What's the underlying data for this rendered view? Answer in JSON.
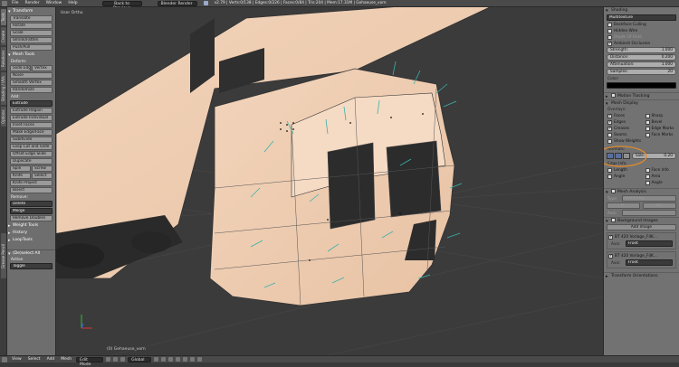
{
  "topbar": {
    "menus": [
      "File",
      "Render",
      "Window",
      "Help"
    ],
    "back_button": "Back to Previous",
    "engine": "Blender Render",
    "stats": "v2.79 | Verts:0/138 | Edges:0/226 | Faces:0/84 | Tris:204 | Mem:17.31M | Gehaeuse_vorn"
  },
  "left_tabs": [
    "Tools",
    "Create",
    "Relations",
    "Shading / UVs",
    "Options",
    "Grease Pencil"
  ],
  "toolshelf": {
    "transform_header": "Transform",
    "transform_buttons": [
      "Translate",
      "Rotate",
      "Scale",
      "Shrink/Fatten",
      "Push/Pull"
    ],
    "mesh_tools_header": "Mesh Tools",
    "deform_label": "Deform:",
    "slide_edge": "Slide Edge",
    "vertex": "Vertex",
    "deform_buttons": [
      "Noise",
      "Smooth Vertex",
      "Randomize"
    ],
    "add_label": "Add:",
    "extrude": "Extrude",
    "add_buttons": [
      "Extrude Region",
      "Extrude Individual",
      "Inset Faces",
      "Make Edge/Face",
      "Subdivide",
      "Loop Cut and Slide",
      "Offset Edge Slide",
      "Duplicate"
    ],
    "spin": "Spin",
    "screw": "Screw",
    "knife": "Knife",
    "select": "Select",
    "knife_project": "Knife Project",
    "bisect": "Bisect",
    "remove_label": "Remove:",
    "delete": "Delete",
    "merge": "Merge",
    "remove_doubles": "Remove Doubles",
    "weight_tools": "Weight Tools",
    "history": "History",
    "looptools": "LoopTools",
    "operator_header": "(De)select All",
    "action_label": "Action",
    "action_value": "Toggle"
  },
  "viewport": {
    "view_label": "User Ortho",
    "object_label": "(0) Gehaeuse_vorn"
  },
  "props": {
    "shading_header": "Shading",
    "shading_mode": "Multitexture",
    "backface": "Backface Culling",
    "hidden_wire": "Hidden Wire",
    "depth_of_field": "Depth Of Field",
    "ambient_occlusion": "Ambient Occlusion",
    "ao_fields": [
      {
        "label": "Strength:",
        "value": "1.000"
      },
      {
        "label": "Distance:",
        "value": "0.200"
      },
      {
        "label": "Attenuation:",
        "value": "1.000"
      },
      {
        "label": "Samples:",
        "value": "20"
      }
    ],
    "color_label": "Color:",
    "motion_tracking": "Motion Tracking",
    "mesh_display": "Mesh Display",
    "overlays_label": "Overlays:",
    "overlay_left": [
      "Faces",
      "Edges",
      "Creases",
      "Seams"
    ],
    "overlay_right": [
      "Sharp",
      "Bevel",
      "Edge Marks",
      "Face Marks"
    ],
    "show_weights": "Show Weights",
    "normals_label": "Normals:",
    "size_label": "Size:",
    "size_value": "0.20",
    "edge_info_label": "Edge Info:",
    "edge_info_left": [
      "Length",
      "Angle"
    ],
    "edge_info_right": [
      "Face Info",
      "Area",
      "Angle"
    ],
    "mesh_analysis": "Mesh Analysis",
    "analysis_type_label": "Type:",
    "analysis_type": "Overhang",
    "analysis_values": [
      "0°",
      "45°"
    ],
    "analysis_axis_label": "Axis:",
    "analysis_axis": "Z",
    "background_images": "Background Images",
    "add_image": "Add Image",
    "bg_images": [
      {
        "name": "BT 420 Vorlage_F4K...",
        "axis_label": "Axis:",
        "axis": "Front"
      },
      {
        "name": "BT 420 Vorlage_F4K...",
        "axis_label": "Axis:",
        "axis": "Front"
      }
    ],
    "transform_orientations": "Transform Orientations"
  },
  "bottombar": {
    "menus": [
      "View",
      "Select",
      "Add",
      "Mesh"
    ],
    "mode": "Edit Mode",
    "pivot": "Global"
  }
}
